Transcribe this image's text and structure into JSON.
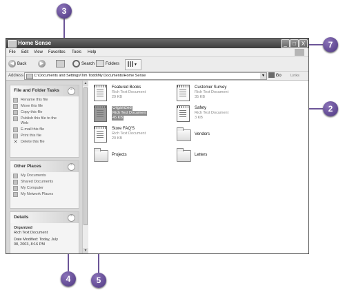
{
  "window": {
    "title": "Home Sense",
    "buttons": [
      "_",
      "□",
      "X"
    ]
  },
  "menu": [
    "File",
    "Edit",
    "View",
    "Favorites",
    "Tools",
    "Help"
  ],
  "toolbar": {
    "back_label": "Back",
    "search_label": "Search",
    "folders_label": "Folders"
  },
  "address": {
    "label": "Address",
    "path": "C:\\Documents and Settings\\Tim Todd\\My Documents\\Home Sense",
    "go_label": "Go",
    "links_label": "Links"
  },
  "panels": {
    "file_tasks": {
      "title": "File and Folder Tasks",
      "items": [
        "Rename this file",
        "Move this file",
        "Copy this file",
        "Publish this file to the",
        "Web",
        "E-mail this file",
        "Print this file",
        "Delete this file"
      ]
    },
    "other_places": {
      "title": "Other Places",
      "items": [
        "My Documents",
        "Shared Documents",
        "My Computer",
        "My Network Places"
      ]
    },
    "details": {
      "title": "Details",
      "name": "Organized",
      "type": "Rich Text Document",
      "modified_line1": "Date Modified: Today, July",
      "modified_line2": "08, 2003, 8:16 PM"
    }
  },
  "files": [
    {
      "name": "Featured Books",
      "type": "Rich Text Document",
      "size": "29 KB",
      "kind": "doc"
    },
    {
      "name": "Customer Survey",
      "type": "Rich Text Document",
      "size": "35 KB",
      "kind": "doc"
    },
    {
      "name": "Organized",
      "type": "Rich Text Document",
      "size": "45 KB",
      "kind": "doc",
      "selected": true
    },
    {
      "name": "Safety",
      "type": "Rich Text Document",
      "size": "3 KB",
      "kind": "doc"
    },
    {
      "name": "Store FAQ'S",
      "type": "Rich Text Document",
      "size": "20 KB",
      "kind": "doc"
    },
    {
      "name": "Vendors",
      "kind": "folder"
    },
    {
      "name": "Projects",
      "kind": "folder"
    },
    {
      "name": "Letters",
      "kind": "folder"
    }
  ],
  "callouts": [
    "3",
    "7",
    "2",
    "4",
    "5"
  ]
}
